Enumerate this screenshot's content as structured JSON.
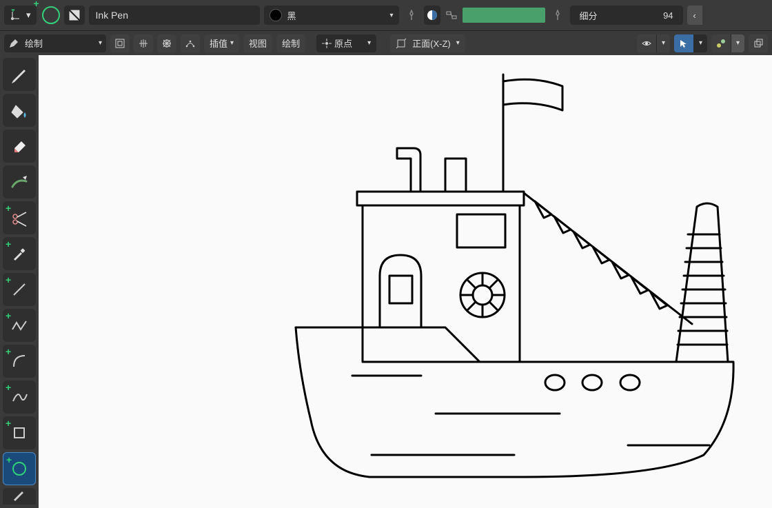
{
  "header": {
    "material": "Ink Pen",
    "color_label": "黑",
    "subdivide_label": "细分",
    "subdivide_value": "94"
  },
  "toolbar": {
    "mode_label": "绘制",
    "interp_label": "插值",
    "view_label": "视图",
    "draw_label": "绘制",
    "origin_label": "原点",
    "axis_label": "正面(X-Z)"
  },
  "tools": [
    {
      "name": "draw"
    },
    {
      "name": "fill"
    },
    {
      "name": "erase"
    },
    {
      "name": "tint"
    },
    {
      "name": "cutter"
    },
    {
      "name": "eyedropper"
    },
    {
      "name": "line"
    },
    {
      "name": "polyline"
    },
    {
      "name": "arc"
    },
    {
      "name": "curve"
    },
    {
      "name": "box"
    },
    {
      "name": "circle"
    },
    {
      "name": "annotate"
    }
  ]
}
